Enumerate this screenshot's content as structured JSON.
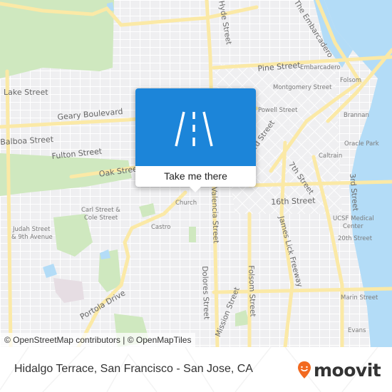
{
  "map": {
    "labels": {
      "hyde": "Hyde Street",
      "embarcadero_road": "The Embarcadero",
      "pine": "Pine Street",
      "embarcadero_station": "Embarcadero",
      "lake": "Lake Street",
      "montgomery": "Montgomery Street",
      "folsom_station": "Folsom",
      "geary": "Geary Boulevard",
      "powell": "Powell Street",
      "brannan": "Brannan",
      "balboa": "Balboa Street",
      "third_st_upper": "3rd Street",
      "fulton": "Fulton Street",
      "oracle": "Oracle Park",
      "caltrain": "Caltrain",
      "oak": "Oak Street",
      "seventh": "7th Street",
      "third": "3rd Street",
      "sixteenth": "16th Street",
      "church": "Church",
      "valencia": "Valencia Street",
      "carl_cole_1": "Carl Street &",
      "carl_cole_2": "Cole Street",
      "judah_1": "Judah Street",
      "judah_2": "& 9th Avenue",
      "castro": "Castro",
      "ucsf_1": "UCSF Medical",
      "ucsf_2": "Center",
      "twentieth": "20th Street",
      "james_lick": "James Lick Freeway",
      "dolores": "Dolores Street",
      "folsom_street": "Folsom Street",
      "portola": "Portola Drive",
      "mission": "Mission Street",
      "marin": "Marin Street",
      "evans": "Evans"
    },
    "attribution": "© OpenStreetMap contributors | © OpenMapTiles",
    "colors": {
      "water": "#b3dcf7",
      "park": "#cfe8bf",
      "major_road": "#fbe9a6",
      "land": "#efeff1"
    }
  },
  "popup": {
    "icon": "road-icon",
    "button_label": "Take me there",
    "color": "#1c85d9"
  },
  "footer": {
    "title": "Hidalgo Terrace, San Francisco - San Jose, CA",
    "logo_text": "moovit",
    "logo_color": "#f26a20"
  }
}
